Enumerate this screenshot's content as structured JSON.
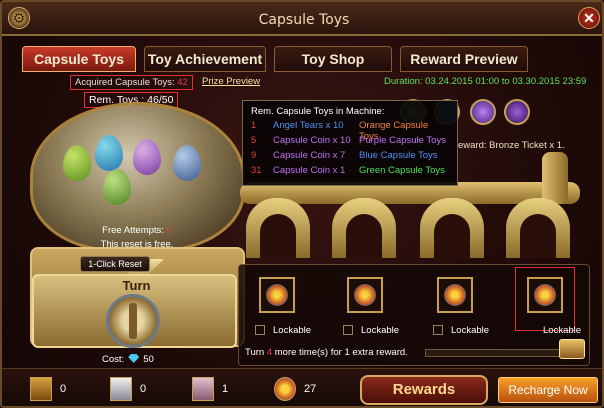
{
  "window": {
    "title": "Capsule Toys"
  },
  "tabs": [
    {
      "label": "Capsule Toys",
      "active": true
    },
    {
      "label": "Toy Achievement",
      "active": false
    },
    {
      "label": "Toy Shop",
      "active": false
    },
    {
      "label": "Reward Preview",
      "active": false
    }
  ],
  "acquired": {
    "label": "Acquired Capsule Toys:",
    "value": "42"
  },
  "prize_preview": "Prize Preview",
  "rem_toys": {
    "label": "Rem. Toys :",
    "value": "46/50"
  },
  "duration": "Duration: 03.24.2015 01:00 to 03.30.2015 23:59",
  "reward_text": "eward: Bronze Ticket x 1.",
  "tooltip": {
    "title": "Rem. Capsule Toys in Machine:",
    "rows": [
      {
        "count": "1",
        "name": "Angel Tears x 10",
        "capsule": "Orange Capsule Toys",
        "color": "#f08040"
      },
      {
        "count": "5",
        "name": "Capsule Coin x 10",
        "capsule": "Purple Capsule Toys",
        "color": "#c070f0"
      },
      {
        "count": "9",
        "name": "Capsule Coin x 7",
        "capsule": "Blue Capsule Toys",
        "color": "#5090f0"
      },
      {
        "count": "31",
        "name": "Capsule Coin x 1",
        "capsule": "Green Capsule Toys",
        "color": "#50e060"
      }
    ]
  },
  "machine": {
    "free_attempts_label": "Free Attempts:",
    "free_attempts_value": "0",
    "reset_free": "This reset is free.",
    "reset_button": "1-Click Reset",
    "turn_label": "Turn",
    "cost_label": "Cost:",
    "cost_value": "50"
  },
  "slots": [
    {
      "label": "Lockable"
    },
    {
      "label": "Lockable"
    },
    {
      "label": "Lockable"
    },
    {
      "label": "Lockable"
    }
  ],
  "extra": {
    "prefix": "Turn",
    "count": "4",
    "suffix": "more time(s) for 1 extra reward."
  },
  "bottom": {
    "items": [
      {
        "value": "0"
      },
      {
        "value": "0"
      },
      {
        "value": "1"
      },
      {
        "value": "27"
      }
    ],
    "rewards_button": "Rewards",
    "recharge_button": "Recharge Now"
  }
}
